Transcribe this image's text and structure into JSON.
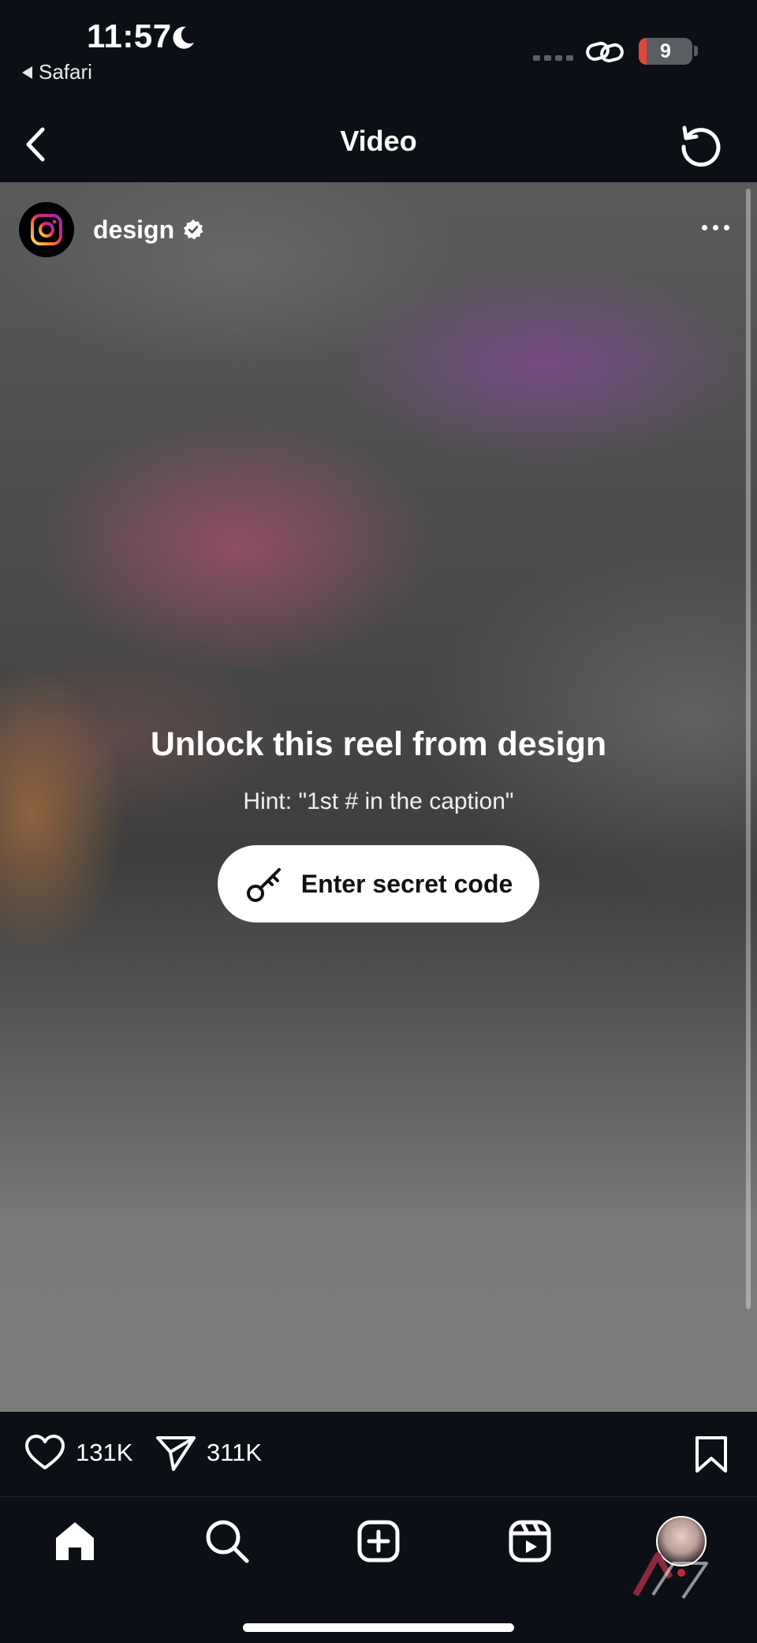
{
  "status_bar": {
    "time": "11:57",
    "back_app": "Safari",
    "battery_level": "9"
  },
  "nav": {
    "title": "Video"
  },
  "post": {
    "username": "design",
    "unlock_title": "Unlock this reel from design",
    "hint": "Hint: \"1st # in the caption\"",
    "code_button_label": "Enter secret code"
  },
  "actions": {
    "likes": "131K",
    "shares": "311K"
  },
  "icons": {
    "status": [
      "moon-icon",
      "link-icon",
      "battery-icon"
    ],
    "nav": [
      "back-chevron-icon",
      "reload-icon"
    ],
    "post": [
      "instagram-logo-icon",
      "verified-icon",
      "more-icon",
      "key-icon"
    ],
    "actions": [
      "heart-icon",
      "send-icon",
      "bookmark-icon"
    ],
    "tabs": [
      "home-icon",
      "search-icon",
      "create-icon",
      "reels-icon",
      "profile-avatar"
    ]
  },
  "colors": {
    "background": "#0c1016",
    "battery_low": "#e4463b",
    "button_bg": "#ffffff"
  }
}
